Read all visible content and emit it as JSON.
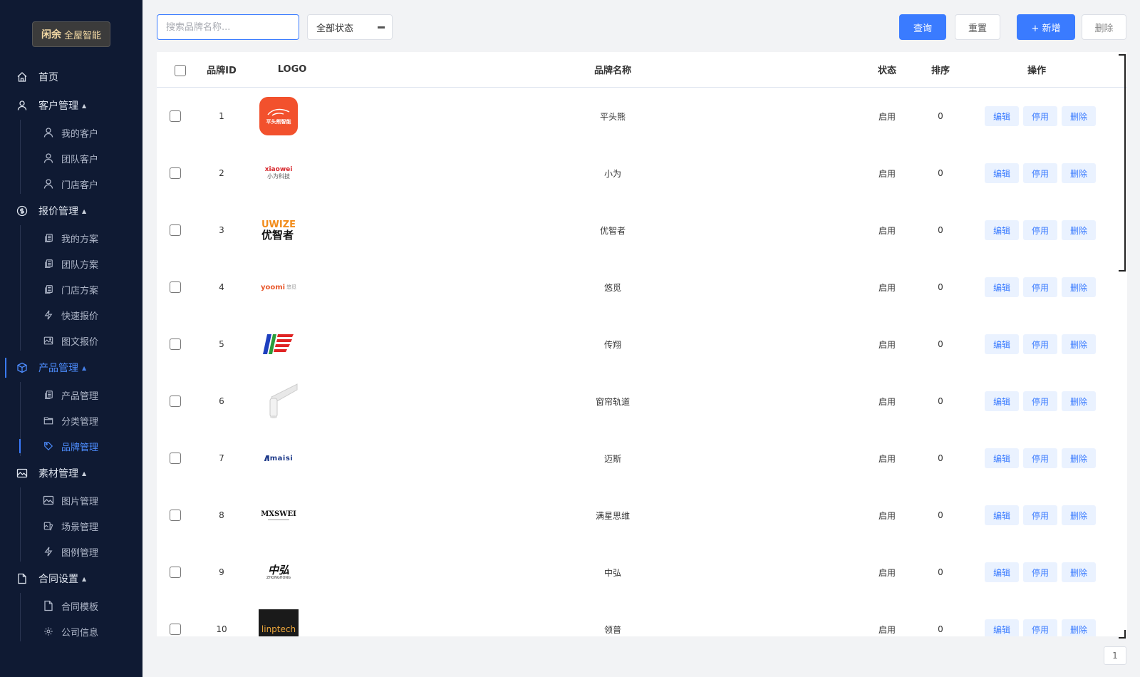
{
  "brand": {
    "mark": "闲余",
    "text": "全屋智能"
  },
  "nav": [
    {
      "label": "首页",
      "icon": "home-icon",
      "caret": ""
    },
    {
      "label": "客户管理",
      "icon": "user-icon",
      "caret": "▲",
      "children": [
        {
          "label": "我的客户",
          "icon": "user-icon"
        },
        {
          "label": "团队客户",
          "icon": "user-icon"
        },
        {
          "label": "门店客户",
          "icon": "user-icon"
        }
      ]
    },
    {
      "label": "报价管理",
      "icon": "dollar-icon",
      "caret": "▲",
      "children": [
        {
          "label": "我的方案",
          "icon": "copy-icon"
        },
        {
          "label": "团队方案",
          "icon": "copy-icon"
        },
        {
          "label": "门店方案",
          "icon": "copy-icon"
        },
        {
          "label": "快速报价",
          "icon": "lightning-icon"
        },
        {
          "label": "图文报价",
          "icon": "image-edit-icon"
        }
      ]
    },
    {
      "label": "产品管理",
      "icon": "box-icon",
      "caret": "▲",
      "active": true,
      "children": [
        {
          "label": "产品管理",
          "icon": "copy-icon"
        },
        {
          "label": "分类管理",
          "icon": "folder-icon"
        },
        {
          "label": "品牌管理",
          "icon": "tag-icon",
          "active": true
        }
      ]
    },
    {
      "label": "素材管理",
      "icon": "picture-icon",
      "caret": "▲",
      "children": [
        {
          "label": "图片管理",
          "icon": "picture-icon"
        },
        {
          "label": "场景管理",
          "icon": "scene-icon"
        },
        {
          "label": "图例管理",
          "icon": "lightning-icon"
        }
      ]
    },
    {
      "label": "合同设置",
      "icon": "document-icon",
      "caret": "▲",
      "children": [
        {
          "label": "合同模板",
          "icon": "document-icon"
        },
        {
          "label": "公司信息",
          "icon": "gear-icon"
        }
      ]
    }
  ],
  "toolbar": {
    "search_placeholder": "搜索品牌名称...",
    "status_value": "全部状态",
    "query": "查询",
    "reset": "重置",
    "add": "+ 新增",
    "delete": "删除"
  },
  "table": {
    "headers": {
      "id": "品牌ID",
      "logo": "LOGO",
      "name": "品牌名称",
      "status": "状态",
      "sort": "排序",
      "ops": "操作"
    },
    "op_labels": {
      "edit": "编辑",
      "disable": "停用",
      "delete": "删除"
    },
    "rows": [
      {
        "id": "1",
        "logo": "pingtouxiong",
        "logo_text": "平头熊智能",
        "name": "平头熊",
        "status": "启用",
        "sort": "0"
      },
      {
        "id": "2",
        "logo": "xiaowei",
        "logo_text": "xiaowei",
        "logo_sub": "小为科技",
        "name": "小为",
        "status": "启用",
        "sort": "0"
      },
      {
        "id": "3",
        "logo": "uwize",
        "logo_text": "UWIZE",
        "logo_sub": "优智者",
        "name": "优智者",
        "status": "启用",
        "sort": "0"
      },
      {
        "id": "4",
        "logo": "yoomi",
        "logo_text": "yoomi",
        "logo_sub": "悠觅",
        "name": "悠觅",
        "status": "启用",
        "sort": "0"
      },
      {
        "id": "5",
        "logo": "chuanxiang",
        "name": "传翔",
        "status": "启用",
        "sort": "0"
      },
      {
        "id": "6",
        "logo": "curtain",
        "name": "窗帘轨道",
        "status": "启用",
        "sort": "0"
      },
      {
        "id": "7",
        "logo": "maisi",
        "logo_text": "maisi",
        "name": "迈斯",
        "status": "启用",
        "sort": "0"
      },
      {
        "id": "8",
        "logo": "mxswei",
        "logo_text": "MXSWEI",
        "name": "满星思维",
        "status": "启用",
        "sort": "0"
      },
      {
        "id": "9",
        "logo": "zhonghong",
        "logo_text": "中弘",
        "logo_sub": "ZHONGHONG",
        "name": "中弘",
        "status": "启用",
        "sort": "0"
      },
      {
        "id": "10",
        "logo": "linptech",
        "logo_text": "linptech",
        "name": "领普",
        "status": "启用",
        "sort": "0"
      }
    ]
  },
  "pager": {
    "page": "1"
  },
  "colors": {
    "primary": "#3a7bff",
    "sidebar": "#0f1a33"
  }
}
